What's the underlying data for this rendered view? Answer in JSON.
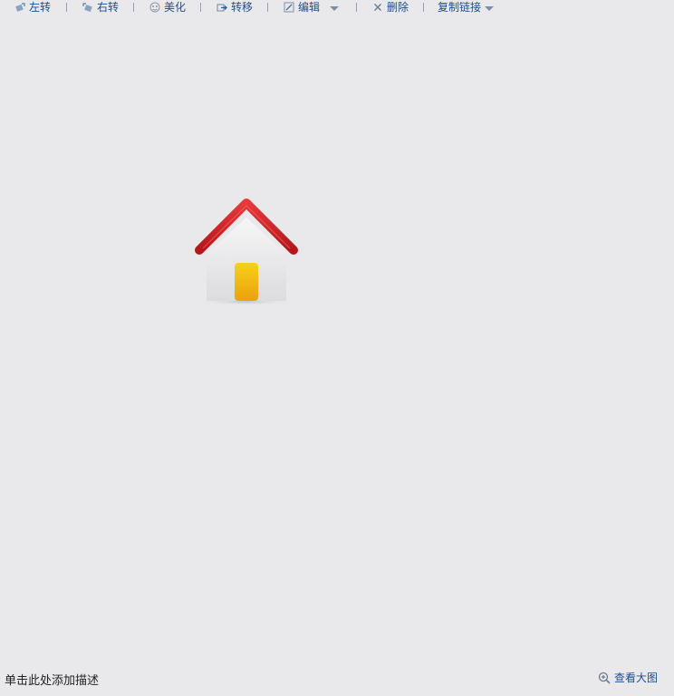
{
  "toolbar": {
    "rotate_left": "左转",
    "rotate_right": "右转",
    "beautify": "美化",
    "move": "转移",
    "edit": "编辑",
    "delete": "删除",
    "copy_link": "复制链接"
  },
  "footer": {
    "description_placeholder": "单击此处添加描述",
    "view_large": "查看大图"
  },
  "colors": {
    "background": "#e9e9ec",
    "link": "#1f4e8a",
    "roof": "#d1252a",
    "door": "#f2b90c"
  },
  "icons": {
    "rotate_left": "rotate-left-icon",
    "rotate_right": "rotate-right-icon",
    "beautify": "beautify-icon",
    "move": "move-icon",
    "edit": "edit-icon",
    "delete": "delete-icon",
    "zoom": "zoom-in-icon",
    "photo": "home-icon"
  }
}
